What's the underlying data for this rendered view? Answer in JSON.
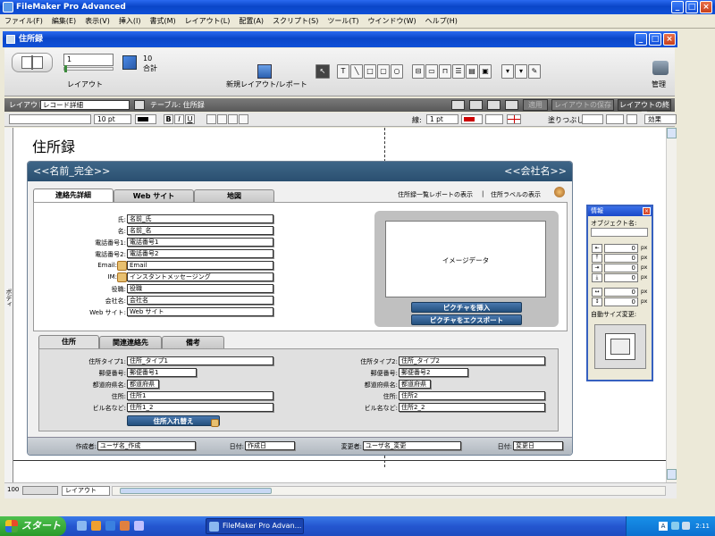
{
  "app": {
    "title": "FileMaker Pro Advanced"
  },
  "menu": [
    "ファイル(F)",
    "編集(E)",
    "表示(V)",
    "挿入(I)",
    "書式(M)",
    "レイアウト(L)",
    "配置(A)",
    "スクリプト(S)",
    "ツール(T)",
    "ウインドウ(W)",
    "ヘルプ(H)"
  ],
  "window": {
    "title": "住所録"
  },
  "status": {
    "layout_number": "1",
    "layout_label": "レイアウト",
    "count": "10",
    "count_label": "合計",
    "new_layout_label": "新規レイアウト/レポート",
    "manage_label": "管理"
  },
  "layout_bar": {
    "layout_label": "レイアウト:",
    "layout_value": "レコード詳細",
    "table_label": "テーブル: 住所録",
    "apply_label": "適用",
    "save_label": "レイアウトの保存",
    "exit_label": "レイアウトの終了"
  },
  "format_bar": {
    "font_size": "10 pt",
    "line_label": "線:",
    "line_value": "1 pt",
    "fill_label": "塗りつぶし:",
    "effect_label": "効果"
  },
  "canvas": {
    "heading": "住所録",
    "part_label": "ボディ"
  },
  "card": {
    "name_field": "<<名前_完全>>",
    "company_field": "<<会社名>>",
    "tabs": [
      "連絡先詳細",
      "Web サイト",
      "地図"
    ],
    "report_link": "住所録一覧レポートの表示",
    "separator": "|",
    "labels_link": "住所ラベルの表示",
    "fields": [
      {
        "label": "氏:",
        "value": "名前_氏"
      },
      {
        "label": "名:",
        "value": "名前_名"
      },
      {
        "label": "電話番号1:",
        "value": "電話番号1"
      },
      {
        "label": "電話番号2:",
        "value": "電話番号2"
      },
      {
        "label": "Email:",
        "value": "Email"
      },
      {
        "label": "IM:",
        "value": "インスタントメッセージング"
      },
      {
        "label": "役職:",
        "value": "役職"
      },
      {
        "label": "会社名:",
        "value": "会社名"
      },
      {
        "label": "Web サイト:",
        "value": "Web サイト"
      }
    ],
    "image_label": "イメージデータ",
    "insert_picture": "ピクチャを挿入",
    "export_picture": "ピクチャをエクスポート",
    "subtabs": [
      "住所",
      "関連連絡先",
      "備考"
    ],
    "address_left": [
      {
        "label": "住所タイプ1:",
        "value": "住所_タイプ1"
      },
      {
        "label": "郵便番号:",
        "value": "郵便番号1"
      },
      {
        "label": "都道府県名:",
        "value": "都道府県"
      },
      {
        "label": "住所:",
        "value": "住所1"
      },
      {
        "label": "ビル名など:",
        "value": "住所1_2"
      }
    ],
    "address_right": [
      {
        "label": "住所タイプ2:",
        "value": "住所_タイプ2"
      },
      {
        "label": "郵便番号:",
        "value": "郵便番号2"
      },
      {
        "label": "都道府県名:",
        "value": "都道府県"
      },
      {
        "label": "住所:",
        "value": "住所2"
      },
      {
        "label": "ビル名など:",
        "value": "住所2_2"
      }
    ],
    "swap_button": "住所入れ替え",
    "footer": [
      {
        "label": "作成者:",
        "value": "ユーザ名_作成"
      },
      {
        "label": "日付:",
        "value": "作成日"
      },
      {
        "label": "変更者:",
        "value": "ユーザ名_変更"
      },
      {
        "label": "日付:",
        "value": "変更日"
      }
    ]
  },
  "info_panel": {
    "title": "情報",
    "object_name_label": "オブジェクト名:",
    "rows": [
      {
        "value": "0",
        "unit": "px"
      },
      {
        "value": "0",
        "unit": "px"
      },
      {
        "value": "0",
        "unit": "px"
      },
      {
        "value": "0",
        "unit": "px"
      },
      {
        "value": "0",
        "unit": "px"
      },
      {
        "value": "0",
        "unit": "px"
      }
    ],
    "autosize_label": "自動サイズ変更:"
  },
  "bottom_bar": {
    "zoom": "100",
    "mode": "レイアウト"
  },
  "taskbar": {
    "start": "スタート",
    "task": "FileMaker Pro Advan...",
    "time": "2:11",
    "ime": "A"
  }
}
